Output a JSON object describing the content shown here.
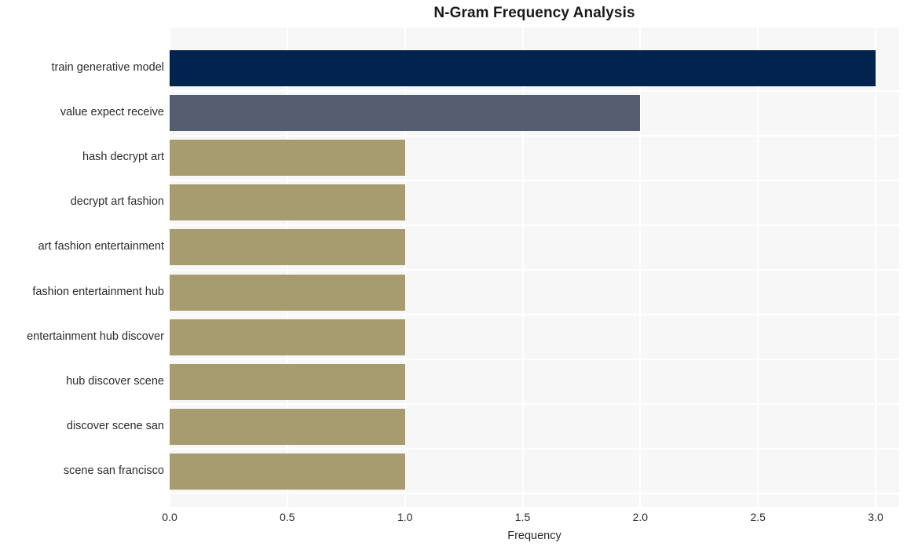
{
  "chart_data": {
    "type": "bar",
    "orientation": "horizontal",
    "title": "N-Gram Frequency Analysis",
    "xlabel": "Frequency",
    "ylabel": "",
    "categories": [
      "train generative model",
      "value expect receive",
      "hash decrypt art",
      "decrypt art fashion",
      "art fashion entertainment",
      "fashion entertainment hub",
      "entertainment hub discover",
      "hub discover scene",
      "discover scene san",
      "scene san francisco"
    ],
    "values": [
      3,
      2,
      1,
      1,
      1,
      1,
      1,
      1,
      1,
      1
    ],
    "bar_colors": [
      "#03234f",
      "#565d70",
      "#a69c70",
      "#a69c70",
      "#a69c70",
      "#a69c70",
      "#a69c70",
      "#a69c70",
      "#a69c70",
      "#a69c70"
    ],
    "xlim": [
      0,
      3.1
    ],
    "xticks": [
      0.0,
      0.5,
      1.0,
      1.5,
      2.0,
      2.5,
      3.0
    ],
    "xtick_labels": [
      "0.0",
      "0.5",
      "1.0",
      "1.5",
      "2.0",
      "2.5",
      "3.0"
    ],
    "grid": true,
    "grid_color": "#ffffff",
    "plot_background": "#f7f7f8",
    "figure_background": "#ffffff",
    "legend": null
  }
}
